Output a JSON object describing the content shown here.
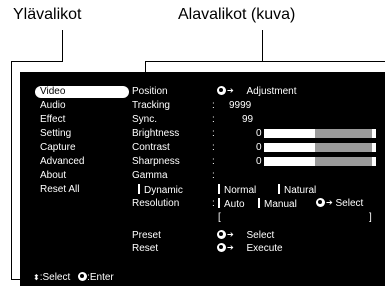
{
  "captions": {
    "top_menus": "Ylävalikot",
    "sub_menus": "Alavalikot (kuva)"
  },
  "main_menu": {
    "items": [
      "Video",
      "Audio",
      "Effect",
      "Setting",
      "Capture",
      "Advanced",
      "About",
      "Reset All"
    ],
    "selected": "Video"
  },
  "sub_menu": {
    "position": {
      "label": "Position",
      "value": "Adjustment"
    },
    "tracking": {
      "label": "Tracking",
      "value": "9999"
    },
    "sync": {
      "label": "Sync.",
      "value": "99"
    },
    "brightness": {
      "label": "Brightness",
      "value": "0",
      "level": 0.45
    },
    "contrast": {
      "label": "Contrast",
      "value": "0",
      "level": 0.45
    },
    "sharpness": {
      "label": "Sharpness",
      "value": "0",
      "level": 0.45
    },
    "gamma": {
      "label": "Gamma",
      "dynamic": "Dynamic",
      "normal": "Normal",
      "natural": "Natural"
    },
    "resolution": {
      "label": "Resolution",
      "auto": "Auto",
      "manual": "Manual",
      "select": "Select",
      "bracket_open": "[",
      "bracket_close": "]"
    },
    "preset": {
      "label": "Preset",
      "value": "Select"
    },
    "reset": {
      "label": "Reset",
      "value": "Execute"
    },
    "colon": ":"
  },
  "footer": {
    "select": ":Select",
    "enter": ":Enter"
  },
  "colors": {
    "screen_bg": "#000000",
    "text": "#ffffff",
    "bar_rest": "#9a9a9a"
  }
}
